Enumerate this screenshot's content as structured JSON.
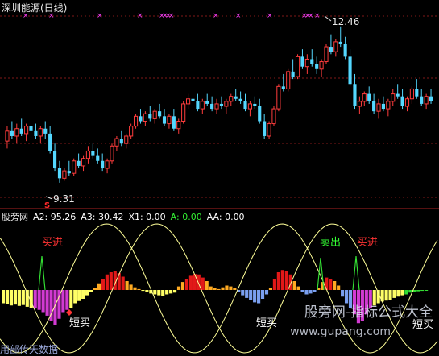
{
  "title": "深圳能源(日线)",
  "price_high_label": "12.46",
  "price_low_label": "9.31",
  "s_marker": "S",
  "indicator": {
    "name": "股旁网",
    "a2": "A2: 95.26",
    "a3": "A3: 30.42",
    "x1": "X1: 0.00",
    "a": "A: 0.00",
    "aa": "AA: 0.00"
  },
  "signals": {
    "buy_in_1": "买进",
    "sell_out": "卖出",
    "buy_in_2": "买进",
    "short_buy_1": "短买",
    "short_buy_2": "短买",
    "short_buy_3": "短买"
  },
  "watermark": "股旁网-指标公式大全",
  "watermark_url": "www.gupang.com",
  "bottom_text": "用部传天数据",
  "colors": {
    "background": "#000000",
    "candle_up": "#ff3c3c",
    "candle_down": "#54d8ff",
    "marker": "#ff40ff",
    "bar_red": "#e21818",
    "bar_yellow": "#ffff66",
    "bar_blue": "#7a9ff0",
    "bar_magenta": "#d23ad2",
    "bar_green": "#33dd33",
    "bar_orange": "#ffaa22",
    "sine": "#ffff99",
    "signal_red": "#ff3333",
    "signal_green": "#33ff33"
  },
  "chart_data": [
    {
      "type": "candlestick",
      "title": "深圳能源(日线)",
      "ylim": [
        9.0,
        12.7
      ],
      "annotations": [
        {
          "label": "12.46",
          "value": 12.46
        },
        {
          "label": "9.31",
          "value": 9.31
        }
      ],
      "candles": [
        [
          10.15,
          10.45,
          10.0,
          10.35
        ],
        [
          10.35,
          10.55,
          10.2,
          10.25
        ],
        [
          10.25,
          10.5,
          10.1,
          10.4
        ],
        [
          10.4,
          10.6,
          10.25,
          10.3
        ],
        [
          10.3,
          10.5,
          10.15,
          10.45
        ],
        [
          10.45,
          10.6,
          10.3,
          10.35
        ],
        [
          10.35,
          10.5,
          10.2,
          10.25
        ],
        [
          10.25,
          10.45,
          10.1,
          10.4
        ],
        [
          10.4,
          10.55,
          10.2,
          10.3
        ],
        [
          10.3,
          10.45,
          9.9,
          9.95
        ],
        [
          9.95,
          10.1,
          9.55,
          9.6
        ],
        [
          9.6,
          9.75,
          9.31,
          9.4
        ],
        [
          9.4,
          9.6,
          9.35,
          9.55
        ],
        [
          9.55,
          9.75,
          9.45,
          9.5
        ],
        [
          9.5,
          9.8,
          9.45,
          9.75
        ],
        [
          9.75,
          9.9,
          9.6,
          9.65
        ],
        [
          9.65,
          9.85,
          9.55,
          9.8
        ],
        [
          9.8,
          10.05,
          9.7,
          9.95
        ],
        [
          9.95,
          10.1,
          9.8,
          9.85
        ],
        [
          9.85,
          10.0,
          9.7,
          9.75
        ],
        [
          9.75,
          9.9,
          9.55,
          9.6
        ],
        [
          9.6,
          9.8,
          9.5,
          9.75
        ],
        [
          9.75,
          10.1,
          9.7,
          10.05
        ],
        [
          10.05,
          10.25,
          9.95,
          10.2
        ],
        [
          10.2,
          10.35,
          10.05,
          10.1
        ],
        [
          10.1,
          10.3,
          10.0,
          10.25
        ],
        [
          10.25,
          10.5,
          10.2,
          10.45
        ],
        [
          10.45,
          10.7,
          10.4,
          10.65
        ],
        [
          10.65,
          10.8,
          10.5,
          10.55
        ],
        [
          10.55,
          10.75,
          10.45,
          10.7
        ],
        [
          10.7,
          10.85,
          10.55,
          10.6
        ],
        [
          10.6,
          10.8,
          10.5,
          10.75
        ],
        [
          10.75,
          10.9,
          10.6,
          10.65
        ],
        [
          10.65,
          10.8,
          10.45,
          10.5
        ],
        [
          10.5,
          10.7,
          10.4,
          10.65
        ],
        [
          10.65,
          10.8,
          10.35,
          10.4
        ],
        [
          10.4,
          10.6,
          10.3,
          10.55
        ],
        [
          10.55,
          10.95,
          10.5,
          10.9
        ],
        [
          10.9,
          11.1,
          10.8,
          11.0
        ],
        [
          11.0,
          11.3,
          10.9,
          10.95
        ],
        [
          10.95,
          11.1,
          10.75,
          10.8
        ],
        [
          10.8,
          11.0,
          10.7,
          10.95
        ],
        [
          10.95,
          11.1,
          10.85,
          10.9
        ],
        [
          10.9,
          11.05,
          10.75,
          10.8
        ],
        [
          10.8,
          11.0,
          10.7,
          10.9
        ],
        [
          10.9,
          11.05,
          10.8,
          10.85
        ],
        [
          10.85,
          11.0,
          10.7,
          10.95
        ],
        [
          10.95,
          11.1,
          10.85,
          11.05
        ],
        [
          11.05,
          11.2,
          10.95,
          11.0
        ],
        [
          11.0,
          11.15,
          10.9,
          10.95
        ],
        [
          10.95,
          11.1,
          10.75,
          10.8
        ],
        [
          10.8,
          10.95,
          10.65,
          10.9
        ],
        [
          10.9,
          11.05,
          10.8,
          10.85
        ],
        [
          10.85,
          11.0,
          10.5,
          10.55
        ],
        [
          10.55,
          10.7,
          10.2,
          10.25
        ],
        [
          10.25,
          10.55,
          10.2,
          10.5
        ],
        [
          10.5,
          10.85,
          10.45,
          10.8
        ],
        [
          10.8,
          11.3,
          10.75,
          11.25
        ],
        [
          11.25,
          11.5,
          11.15,
          11.2
        ],
        [
          11.2,
          11.6,
          11.15,
          11.55
        ],
        [
          11.55,
          11.8,
          11.4,
          11.45
        ],
        [
          11.45,
          11.9,
          11.4,
          11.85
        ],
        [
          11.85,
          12.0,
          11.6,
          11.65
        ],
        [
          11.65,
          11.9,
          11.5,
          11.8
        ],
        [
          11.8,
          12.0,
          11.65,
          11.7
        ],
        [
          11.7,
          11.85,
          11.5,
          11.6
        ],
        [
          11.6,
          11.8,
          11.45,
          11.75
        ],
        [
          11.75,
          12.1,
          11.7,
          12.05
        ],
        [
          12.05,
          12.3,
          11.9,
          11.95
        ],
        [
          11.95,
          12.2,
          11.85,
          12.15
        ],
        [
          12.15,
          12.46,
          12.05,
          12.1
        ],
        [
          12.1,
          12.25,
          11.8,
          11.85
        ],
        [
          11.85,
          12.0,
          11.25,
          11.3
        ],
        [
          11.3,
          11.5,
          10.8,
          10.85
        ],
        [
          10.85,
          11.05,
          10.7,
          10.95
        ],
        [
          10.95,
          11.15,
          10.85,
          11.1
        ],
        [
          11.1,
          11.25,
          10.9,
          10.95
        ],
        [
          10.95,
          11.1,
          10.7,
          10.75
        ],
        [
          10.75,
          11.0,
          10.6,
          10.9
        ],
        [
          10.9,
          11.05,
          10.75,
          10.8
        ],
        [
          10.8,
          11.0,
          10.65,
          10.95
        ],
        [
          10.95,
          11.2,
          10.85,
          11.1
        ],
        [
          11.1,
          11.3,
          11.0,
          11.05
        ],
        [
          11.05,
          11.2,
          10.8,
          10.85
        ],
        [
          10.85,
          11.05,
          10.75,
          11.0
        ],
        [
          11.0,
          11.25,
          10.9,
          11.2
        ],
        [
          11.2,
          11.4,
          11.0,
          11.05
        ],
        [
          11.05,
          11.2,
          10.85,
          10.9
        ],
        [
          10.9,
          11.1,
          10.8,
          11.05
        ],
        [
          11.05,
          11.2,
          10.9,
          10.95
        ]
      ]
    },
    {
      "type": "bar",
      "title": "股旁网",
      "ylim": [
        -100,
        100
      ],
      "series": [
        {
          "name": "A2",
          "values": [
            -30,
            -32,
            -35,
            -33,
            -36,
            -34,
            -38,
            -40,
            -42,
            -45,
            -50,
            -58,
            -70,
            -80,
            -65,
            -50,
            -45,
            -40,
            -30,
            -25,
            -20,
            -12,
            -5,
            5,
            15,
            25,
            35,
            40,
            42,
            38,
            30,
            20,
            12,
            6,
            2,
            -2,
            -5,
            -8,
            -10,
            -12,
            -14,
            -10,
            -8,
            -6,
            8,
            18,
            25,
            32,
            36,
            35,
            28,
            20,
            8,
            4,
            2,
            6,
            10,
            8,
            4,
            -5,
            -12,
            -18,
            -22,
            -28,
            -30,
            -20,
            -10,
            5,
            25,
            40,
            45,
            42,
            35,
            20,
            8,
            -4,
            -10,
            -8,
            -5,
            4,
            18,
            28,
            25,
            20,
            10,
            -15,
            -30,
            -40,
            -55,
            -75,
            -70,
            -55,
            -42,
            -35,
            -30,
            -26,
            -24,
            -22,
            -18,
            -15,
            -12,
            -10,
            -6,
            -4,
            -3,
            -2,
            -1
          ]
        }
      ],
      "annotations": [
        "买进",
        "卖出",
        "买进",
        "短买",
        "短买",
        "短买"
      ]
    }
  ]
}
